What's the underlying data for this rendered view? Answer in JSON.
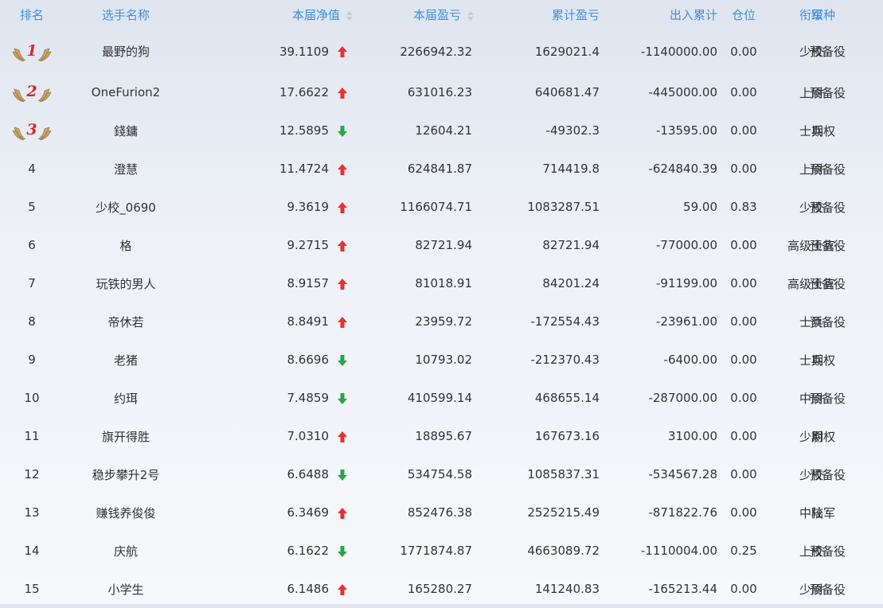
{
  "headers": {
    "rank": "排名",
    "name": "选手名称",
    "nav": "本届净值",
    "pnl": "本届盈亏",
    "cum": "累计盈亏",
    "flow": "出入累计",
    "position": "仓位",
    "grade": "衔级",
    "type": "军种"
  },
  "colors": {
    "up": "#e8322f",
    "down": "#28a745",
    "header": "#3d8fe0",
    "medal": "#d9252b"
  },
  "rows": [
    {
      "rank": "1",
      "name": "最野的狗",
      "nav": "39.1109",
      "trend": "up",
      "pnl": "2266942.32",
      "cum": "1629021.4",
      "flow": "-1140000.00",
      "pos": "0.00",
      "grade": "少校",
      "type": "预备役"
    },
    {
      "rank": "2",
      "name": "OneFurion2",
      "nav": "17.6622",
      "trend": "up",
      "pnl": "631016.23",
      "cum": "640681.47",
      "flow": "-445000.00",
      "pos": "0.00",
      "grade": "上尉",
      "type": "预备役"
    },
    {
      "rank": "3",
      "name": "錢鏞",
      "nav": "12.5895",
      "trend": "down",
      "pnl": "12604.21",
      "cum": "-49302.3",
      "flow": "-13595.00",
      "pos": "0.00",
      "grade": "士兵",
      "type": "期权"
    },
    {
      "rank": "4",
      "name": "澄慧",
      "nav": "11.4724",
      "trend": "up",
      "pnl": "624841.87",
      "cum": "714419.8",
      "flow": "-624840.39",
      "pos": "0.00",
      "grade": "上尉",
      "type": "预备役"
    },
    {
      "rank": "5",
      "name": "少校_0690",
      "nav": "9.3619",
      "trend": "up",
      "pnl": "1166074.71",
      "cum": "1083287.51",
      "flow": "59.00",
      "pos": "0.83",
      "grade": "少校",
      "type": "预备役"
    },
    {
      "rank": "6",
      "name": "格",
      "nav": "9.2715",
      "trend": "up",
      "pnl": "82721.94",
      "cum": "82721.94",
      "flow": "-77000.00",
      "pos": "0.00",
      "grade": "高级士官",
      "type": "预备役"
    },
    {
      "rank": "7",
      "name": "玩铁的男人",
      "nav": "8.9157",
      "trend": "up",
      "pnl": "81018.91",
      "cum": "84201.24",
      "flow": "-91199.00",
      "pos": "0.00",
      "grade": "高级士官",
      "type": "预备役"
    },
    {
      "rank": "8",
      "name": "帝休若",
      "nav": "8.8491",
      "trend": "up",
      "pnl": "23959.72",
      "cum": "-172554.43",
      "flow": "-23961.00",
      "pos": "0.00",
      "grade": "士兵",
      "type": "预备役"
    },
    {
      "rank": "9",
      "name": "老猪",
      "nav": "8.6696",
      "trend": "down",
      "pnl": "10793.02",
      "cum": "-212370.43",
      "flow": "-6400.00",
      "pos": "0.00",
      "grade": "士兵",
      "type": "期权"
    },
    {
      "rank": "10",
      "name": "约珥",
      "nav": "7.4859",
      "trend": "down",
      "pnl": "410599.14",
      "cum": "468655.14",
      "flow": "-287000.00",
      "pos": "0.00",
      "grade": "中尉",
      "type": "预备役"
    },
    {
      "rank": "11",
      "name": "旗开得胜",
      "nav": "7.0310",
      "trend": "up",
      "pnl": "18895.67",
      "cum": "167673.16",
      "flow": "3100.00",
      "pos": "0.00",
      "grade": "少尉",
      "type": "期权"
    },
    {
      "rank": "12",
      "name": "稳步攀升2号",
      "nav": "6.6488",
      "trend": "down",
      "pnl": "534754.58",
      "cum": "1085837.31",
      "flow": "-534567.28",
      "pos": "0.00",
      "grade": "少校",
      "type": "预备役"
    },
    {
      "rank": "13",
      "name": "赚钱养俊俊",
      "nav": "6.3469",
      "trend": "up",
      "pnl": "852476.38",
      "cum": "2525215.49",
      "flow": "-871822.76",
      "pos": "0.00",
      "grade": "中校",
      "type": "陆军"
    },
    {
      "rank": "14",
      "name": "庆航",
      "nav": "6.1622",
      "trend": "down",
      "pnl": "1771874.87",
      "cum": "4663089.72",
      "flow": "-1110004.00",
      "pos": "0.25",
      "grade": "上校",
      "type": "预备役"
    },
    {
      "rank": "15",
      "name": "小学生",
      "nav": "6.1486",
      "trend": "up",
      "pnl": "165280.27",
      "cum": "141240.83",
      "flow": "-165213.44",
      "pos": "0.00",
      "grade": "少尉",
      "type": "预备役"
    }
  ]
}
